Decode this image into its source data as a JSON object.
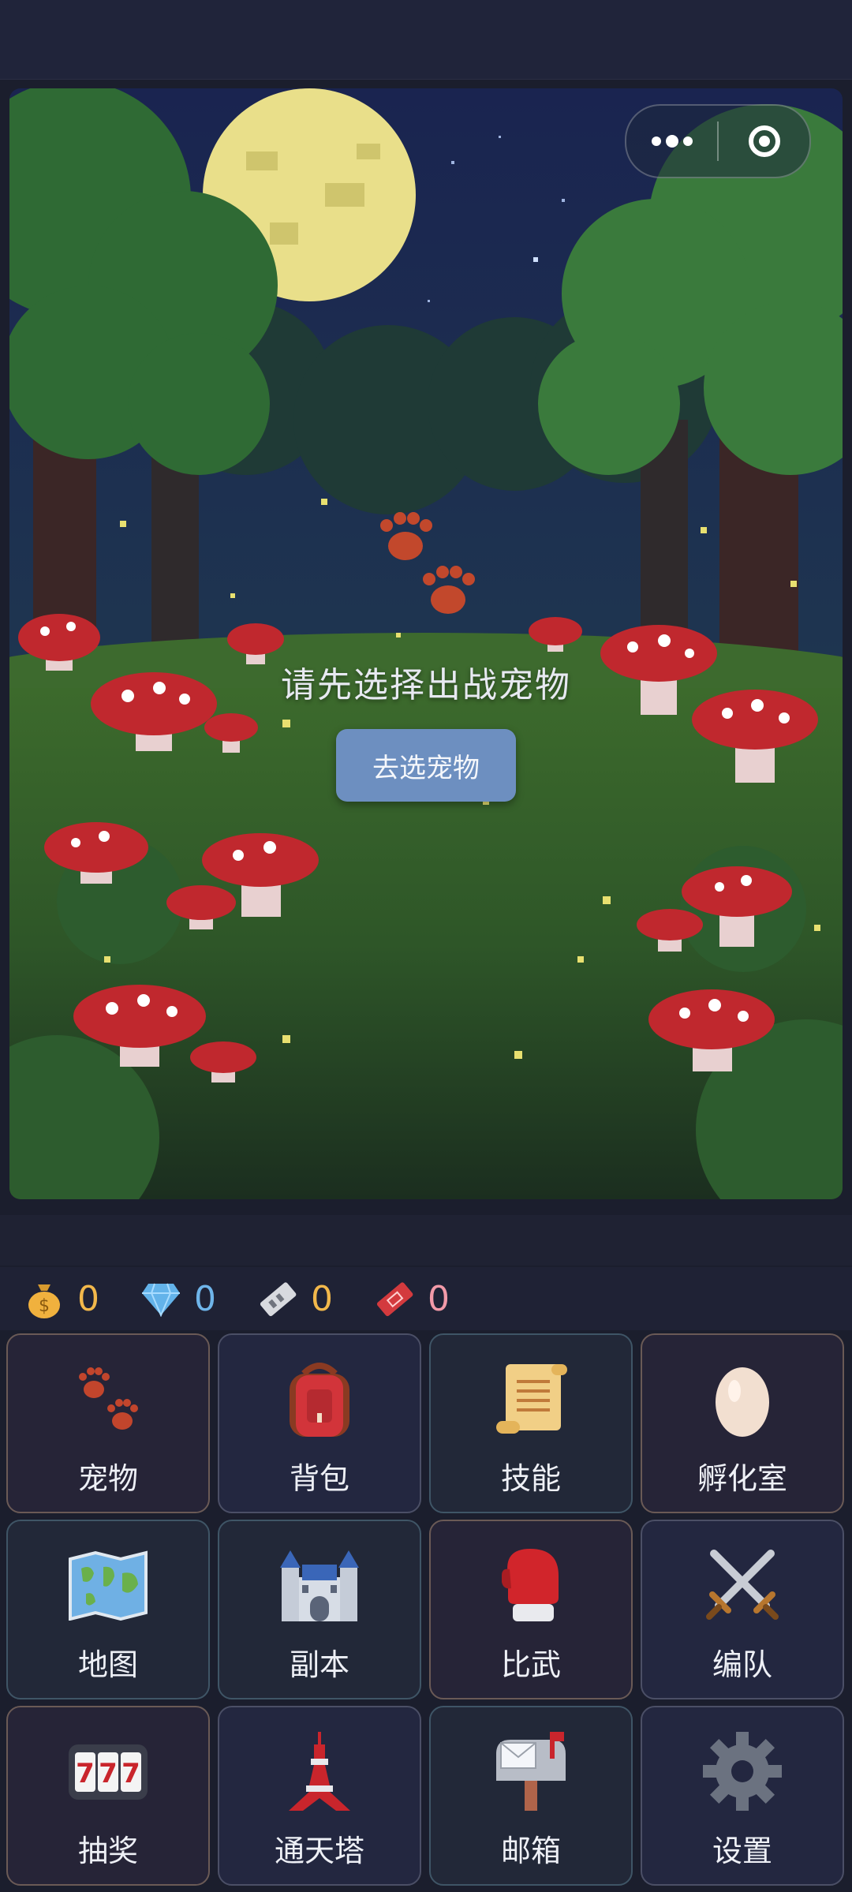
{
  "scene": {
    "prompt": "请先选择出战宠物",
    "button_label": "去选宠物"
  },
  "capsule": {
    "more_icon": "more-dots-icon",
    "close_icon": "target-circle-icon"
  },
  "currency": [
    {
      "icon": "money-bag-icon",
      "value": "0",
      "color": "#f2b84b"
    },
    {
      "icon": "diamond-icon",
      "value": "0",
      "color": "#6fb5ea"
    },
    {
      "icon": "ticket-gray-icon",
      "value": "0",
      "color": "#f2b84b"
    },
    {
      "icon": "ticket-red-icon",
      "value": "0",
      "color": "#f29aa8"
    }
  ],
  "menu": [
    {
      "label": "宠物",
      "icon": "paw-prints-icon"
    },
    {
      "label": "背包",
      "icon": "backpack-icon"
    },
    {
      "label": "技能",
      "icon": "scroll-icon"
    },
    {
      "label": "孵化室",
      "icon": "egg-icon"
    },
    {
      "label": "地图",
      "icon": "world-map-icon"
    },
    {
      "label": "副本",
      "icon": "castle-icon"
    },
    {
      "label": "比武",
      "icon": "boxing-glove-icon"
    },
    {
      "label": "编队",
      "icon": "crossed-swords-icon"
    },
    {
      "label": "抽奖",
      "icon": "slot-machine-icon"
    },
    {
      "label": "通天塔",
      "icon": "tower-icon"
    },
    {
      "label": "邮箱",
      "icon": "mailbox-icon"
    },
    {
      "label": "设置",
      "icon": "gear-icon"
    }
  ]
}
